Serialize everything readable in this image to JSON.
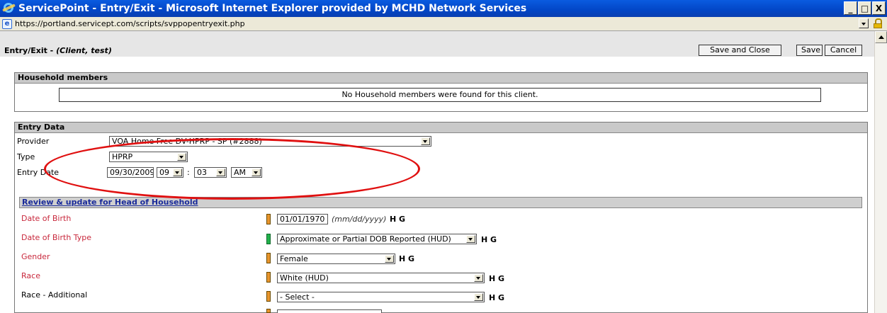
{
  "window": {
    "title": "ServicePoint - Entry/Exit - Microsoft Internet Explorer provided by MCHD Network Services",
    "url": "https://portland.servicept.com/scripts/svppopentryexit.php",
    "minimize": "_",
    "maximize": "□",
    "close": "X"
  },
  "header": {
    "title_prefix": "Entry/Exit - ",
    "title_client": "(Client, test)",
    "save_close_label": "Save and Close",
    "save_label": "Save",
    "cancel_label": "Cancel"
  },
  "household": {
    "heading": "Household members",
    "empty_message": "No Household members were found for this client."
  },
  "entry": {
    "heading": "Entry Data",
    "provider_label": "Provider",
    "provider_value": "VOA Home Free DV-HPRP - SP (#2888)",
    "type_label": "Type",
    "type_value": "HPRP",
    "entry_date_label": "Entry Date",
    "entry_date_value": "09/30/2009",
    "hour_value": "09",
    "time_sep": ":",
    "minute_value": "03",
    "ampm_value": "AM"
  },
  "review": {
    "heading": "Review & update for Head of Household",
    "hg_text": "H G",
    "rows": [
      {
        "label": "Date of Birth",
        "value": "01/01/1970",
        "hint": "(mm/dd/yyyy)",
        "indicator_color": "#e8952e",
        "required": true
      },
      {
        "label": "Date of Birth Type",
        "value": "Approximate or Partial DOB Reported (HUD)",
        "indicator_color": "#22b14c",
        "required": true
      },
      {
        "label": "Gender",
        "value": "Female",
        "indicator_color": "#e8952e",
        "required": true
      },
      {
        "label": "Race",
        "value": "White (HUD)",
        "indicator_color": "#e8952e",
        "required": true
      },
      {
        "label": "Race - Additional",
        "value": "- Select -",
        "indicator_color": "#e8952e",
        "required": false
      }
    ]
  },
  "annotation": {
    "color": "#e01010"
  }
}
